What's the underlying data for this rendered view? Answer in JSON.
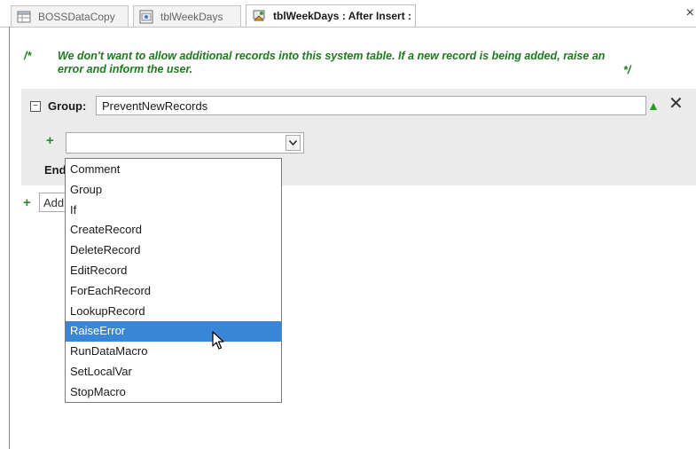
{
  "tabs": [
    {
      "label": "BOSSDataCopy",
      "icon": "table-icon"
    },
    {
      "label": "tblWeekDays",
      "icon": "table-datasheet-icon"
    },
    {
      "label": "tblWeekDays : After Insert :",
      "icon": "data-macro-icon",
      "active": true
    }
  ],
  "window_close": "×",
  "comment": {
    "open": "/*",
    "text": "We don't want to allow additional records into this system table. If a new record is being added, raise an error and inform the user.",
    "close": "*/"
  },
  "group": {
    "label": "Group:",
    "name_value": "PreventNewRecords",
    "end_label": "End"
  },
  "add_action": {
    "plus": "+",
    "combo_value": "",
    "bottom_value": "Add New Action"
  },
  "dropdown": {
    "selected_index": 8,
    "options": [
      "Comment",
      "Group",
      "If",
      "CreateRecord",
      "DeleteRecord",
      "EditRecord",
      "ForEachRecord",
      "LookupRecord",
      "RaiseError",
      "RunDataMacro",
      "SetLocalVar",
      "StopMacro"
    ]
  },
  "colors": {
    "comment_text": "#1e7a1e",
    "selection": "#3a86d6",
    "group_background": "#ebebeb",
    "plus_green": "#2a8a2a"
  }
}
